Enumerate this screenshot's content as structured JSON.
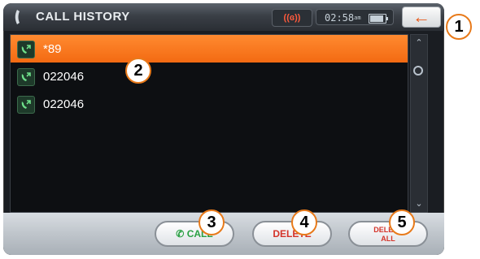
{
  "header": {
    "title": "CALL HISTORY",
    "bluetooth_badge": "((ɞ))",
    "clock": "02:58",
    "clock_suffix": "am",
    "back_label": "←",
    "battery_level": 0.8
  },
  "call_list": [
    {
      "number": "*89",
      "selected": true
    },
    {
      "number": "022046",
      "selected": false
    },
    {
      "number": "022046",
      "selected": false
    }
  ],
  "scrollbar": {
    "up_label": "⌃",
    "down_label": "⌄"
  },
  "buttons": {
    "call": "CALL",
    "delete": "DELETE",
    "delete_all_line1": "DELETE",
    "delete_all_line2": "ALL"
  },
  "callouts": [
    "1",
    "2",
    "3",
    "4",
    "5"
  ],
  "colors": {
    "accent_orange": "#f36a12",
    "call_green": "#2aa043",
    "delete_red": "#d4342a"
  }
}
